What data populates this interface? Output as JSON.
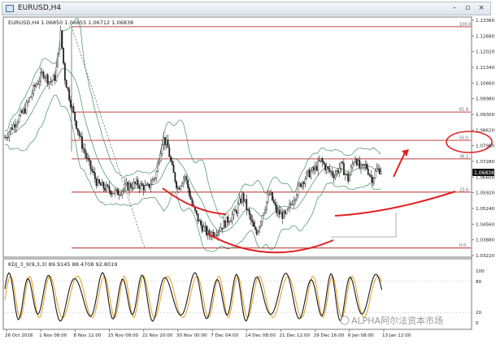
{
  "window": {
    "title": "EURUSD,H4",
    "controls": {
      "minimize": "–",
      "restore": "▫",
      "close": "×"
    }
  },
  "main_chart": {
    "info": "EURUSD,H4  1.06850 1.06855 1.06712 1.06838",
    "price_labels": [
      "1.13360",
      "1.12680",
      "1.12020",
      "1.11340",
      "1.10660",
      "1.09980",
      "1.09300",
      "1.08620",
      "1.07960",
      "1.07280",
      "1.06600",
      "1.05920",
      "1.05240",
      "1.04560",
      "1.03880",
      "1.03220"
    ],
    "current_price": "1.06838",
    "fib_levels": [
      {
        "label": "100.0",
        "price": 1.1298
      },
      {
        "label": "61.8",
        "price": 1.093
      },
      {
        "label": "50.0",
        "price": 1.0808
      },
      {
        "label": "38.2",
        "price": 1.0728
      },
      {
        "label": "23.6",
        "price": 1.0585
      },
      {
        "label": "0.0",
        "price": 1.0344
      }
    ],
    "time_labels": [
      "26 Oct 2016",
      "1 Nov 08:00",
      "8 Nov 12:00",
      "15 Nov 08:00",
      "22 Nov 20:00",
      "30 Nov 00:00",
      "7 Dec 04:00",
      "14 Dec 08:00",
      "21 Dec 12:00",
      "29 Dec 16:00",
      "6 Jan 08:00",
      "13 Jan 12:00"
    ]
  },
  "indicator": {
    "label": "KDJ_3_9(9,3,3) 89.9145 88.4708 92.8019",
    "levels": [
      "100",
      "80",
      "20",
      "0"
    ]
  },
  "watermark": "ALPHA阿尔法资本市场",
  "colors": {
    "candle": "#222222",
    "bollinger": "#3f8f5f",
    "fib": "#c04040",
    "annotation": "#e02020",
    "kdj_k": "#1a1a1a",
    "kdj_d": "#e0a020"
  }
}
